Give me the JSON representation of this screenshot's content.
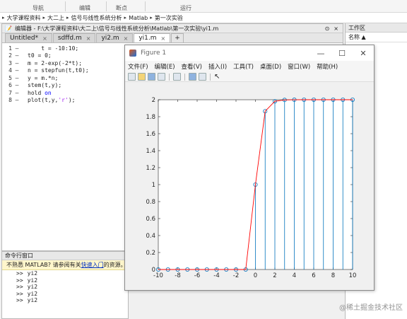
{
  "ribbon": {
    "labels": [
      "导航",
      "编辑",
      "断点",
      "运行"
    ]
  },
  "breadcrumb": [
    "大学课程资料",
    "大二上",
    "信号与线性系统分析",
    "Matlab",
    "第一次实验"
  ],
  "editor": {
    "title": "编辑器 - F:\\大学课程资料\\大二上\\信号与线性系统分析\\Matlab\\第一次实验\\yi1.m",
    "tabs": [
      {
        "label": "Untitled*",
        "close": "×"
      },
      {
        "label": "sdffd.m",
        "close": "×"
      },
      {
        "label": "yi2.m",
        "close": "×"
      },
      {
        "label": "yi1.m",
        "close": "×"
      }
    ],
    "add_tab": "+",
    "lines": [
      {
        "num": "1",
        "dash": "–",
        "code": "    t = -10:10;"
      },
      {
        "num": "2",
        "dash": "–",
        "code": "t0 = 0;"
      },
      {
        "num": "3",
        "dash": "–",
        "code": "m = 2-exp(-2*t);"
      },
      {
        "num": "4",
        "dash": "–",
        "code": "n = stepfun(t,t0);"
      },
      {
        "num": "5",
        "dash": "–",
        "code": "y = m.*n;"
      },
      {
        "num": "6",
        "dash": "–",
        "code": "stem(t,y);"
      },
      {
        "num": "7",
        "dash": "–",
        "code_pre": "hold ",
        "code_kw": "on"
      },
      {
        "num": "8",
        "dash": "–",
        "code_pre": "plot(t,y,",
        "code_str": "'r'",
        "code_post": ");"
      }
    ]
  },
  "command_window": {
    "title": "命令行窗口",
    "notice_pre": "不熟悉 MATLAB? 请参阅有关",
    "notice_link": "快速入门",
    "notice_post": "的资源。",
    "history": [
      {
        "prompt": ">>",
        "cmd": "yi2"
      },
      {
        "prompt": ">>",
        "cmd": "yi2"
      },
      {
        "prompt": ">>",
        "cmd": "yi2"
      },
      {
        "prompt": ">>",
        "cmd": "yi2"
      },
      {
        "prompt": ">>",
        "cmd": "yi2"
      }
    ]
  },
  "workspace": {
    "title": "工作区",
    "col_name": "名称 ▲"
  },
  "figure": {
    "title": "Figure 1",
    "menu": [
      "文件(F)",
      "编辑(E)",
      "查看(V)",
      "插入(I)",
      "工具(T)",
      "桌面(D)",
      "窗口(W)",
      "帮助(H)"
    ],
    "controls": [
      "—",
      "☐",
      "✕"
    ]
  },
  "chart_data": {
    "type": "line",
    "x": [
      -10,
      -9,
      -8,
      -7,
      -6,
      -5,
      -4,
      -3,
      -2,
      -1,
      0,
      1,
      2,
      3,
      4,
      5,
      6,
      7,
      8,
      9,
      10
    ],
    "series": [
      {
        "kind": "stem",
        "color": "#0072bd",
        "values": [
          0,
          0,
          0,
          0,
          0,
          0,
          0,
          0,
          0,
          0,
          1,
          1.8647,
          1.9817,
          1.9975,
          1.9997,
          2,
          2,
          2,
          2,
          2,
          2
        ]
      },
      {
        "kind": "line",
        "color": "#ff0000",
        "values": [
          0,
          0,
          0,
          0,
          0,
          0,
          0,
          0,
          0,
          0,
          1,
          1.8647,
          1.9817,
          1.9975,
          1.9997,
          2,
          2,
          2,
          2,
          2,
          2
        ]
      }
    ],
    "xlim": [
      -10,
      10
    ],
    "ylim": [
      0,
      2
    ],
    "xticks": [
      -10,
      -8,
      -6,
      -4,
      -2,
      0,
      2,
      4,
      6,
      8,
      10
    ],
    "yticks": [
      0,
      0.2,
      0.4,
      0.6,
      0.8,
      1,
      1.2,
      1.4,
      1.6,
      1.8,
      2
    ],
    "title": "",
    "xlabel": "",
    "ylabel": "",
    "grid": false
  },
  "watermark": "@稀土掘金技术社区"
}
